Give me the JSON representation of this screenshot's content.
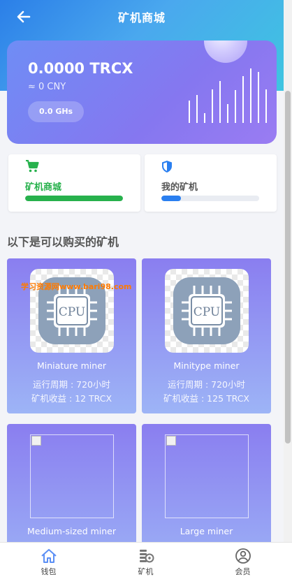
{
  "header": {
    "title": "矿机商城"
  },
  "wallet": {
    "amount": "0.0000 TRCX",
    "cny": "≈ 0 CNY",
    "hashrate": "0.0 GHs",
    "bar_heights": [
      32,
      40,
      14,
      48,
      60,
      27,
      47,
      67,
      78,
      73,
      48
    ]
  },
  "quick_cards": [
    {
      "label": "矿机商城",
      "color": "#27b14c",
      "progress": 1.0
    },
    {
      "label": "我的矿机",
      "color": "#2a7ff0",
      "progress": 0.2
    }
  ],
  "section_title": "以下是可以购买的矿机",
  "watermark": "学习资源网www.bari98.com",
  "miners": [
    {
      "name": "Miniature miner",
      "period": "运行周期 : 720小时",
      "income": "矿机收益 : 12 TRCX",
      "icon": "cpu-chip-icon"
    },
    {
      "name": "Minitype miner",
      "period": "运行周期 : 720小时",
      "income": "矿机收益 : 125 TRCX",
      "icon": "cpu-chip-icon"
    },
    {
      "name": "Medium-sized miner",
      "icon": "broken-image-icon"
    },
    {
      "name": "Large miner",
      "icon": "broken-image-icon"
    }
  ],
  "tabbar": [
    {
      "label": "钱包",
      "icon": "home-icon",
      "active": true
    },
    {
      "label": "矿机",
      "icon": "miner-icon",
      "active": false
    },
    {
      "label": "会员",
      "icon": "user-icon",
      "active": false
    }
  ]
}
